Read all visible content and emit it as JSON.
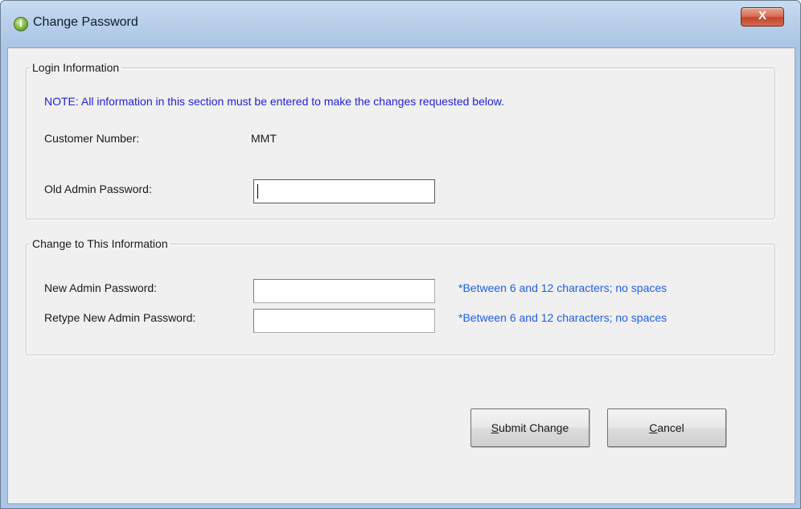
{
  "window": {
    "title": "Change Password",
    "close_label": "X"
  },
  "login_group": {
    "legend": "Login Information",
    "note": "NOTE: All information in this section must be entered to make the changes requested below.",
    "customer_number_label": "Customer Number:",
    "customer_number_value": "MMT",
    "old_password_label": "Old Admin Password:",
    "old_password_value": ""
  },
  "change_group": {
    "legend": "Change to This Information",
    "new_password_label": "New Admin Password:",
    "new_password_value": "",
    "new_password_hint": "*Between 6 and 12 characters; no spaces",
    "retype_password_label": "Retype New Admin Password:",
    "retype_password_value": "",
    "retype_password_hint": "*Between 6 and 12 characters; no spaces"
  },
  "buttons": {
    "submit_mnemonic": "S",
    "submit_rest": "ubmit Change",
    "cancel_mnemonic": "C",
    "cancel_rest": "ancel"
  },
  "colors": {
    "note": "#1f1fd8",
    "hint": "#1f5fe8",
    "close": "#c2462d"
  },
  "icons": {
    "title": "info-icon"
  }
}
